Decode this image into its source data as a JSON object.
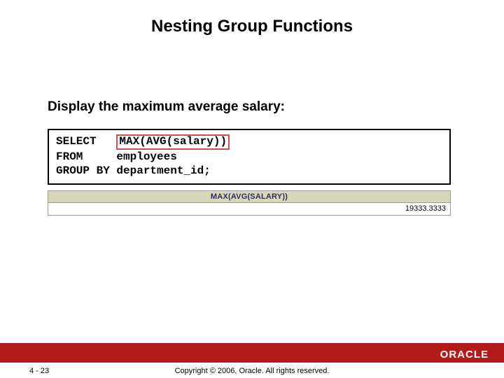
{
  "slide": {
    "title": "Nesting Group Functions",
    "subtitle": "Display the maximum average salary:"
  },
  "code": {
    "line1_keyword": "SELECT   ",
    "line1_expr": "MAX(AVG(salary))",
    "line2": "FROM     employees",
    "line3": "GROUP BY department_id;"
  },
  "result": {
    "header": "MAX(AVG(SALARY))",
    "value": "19333.3333"
  },
  "footer": {
    "page": "4 - 23",
    "copyright": "Copyright © 2006, Oracle. All rights reserved.",
    "logo_text": "ORACLE"
  }
}
